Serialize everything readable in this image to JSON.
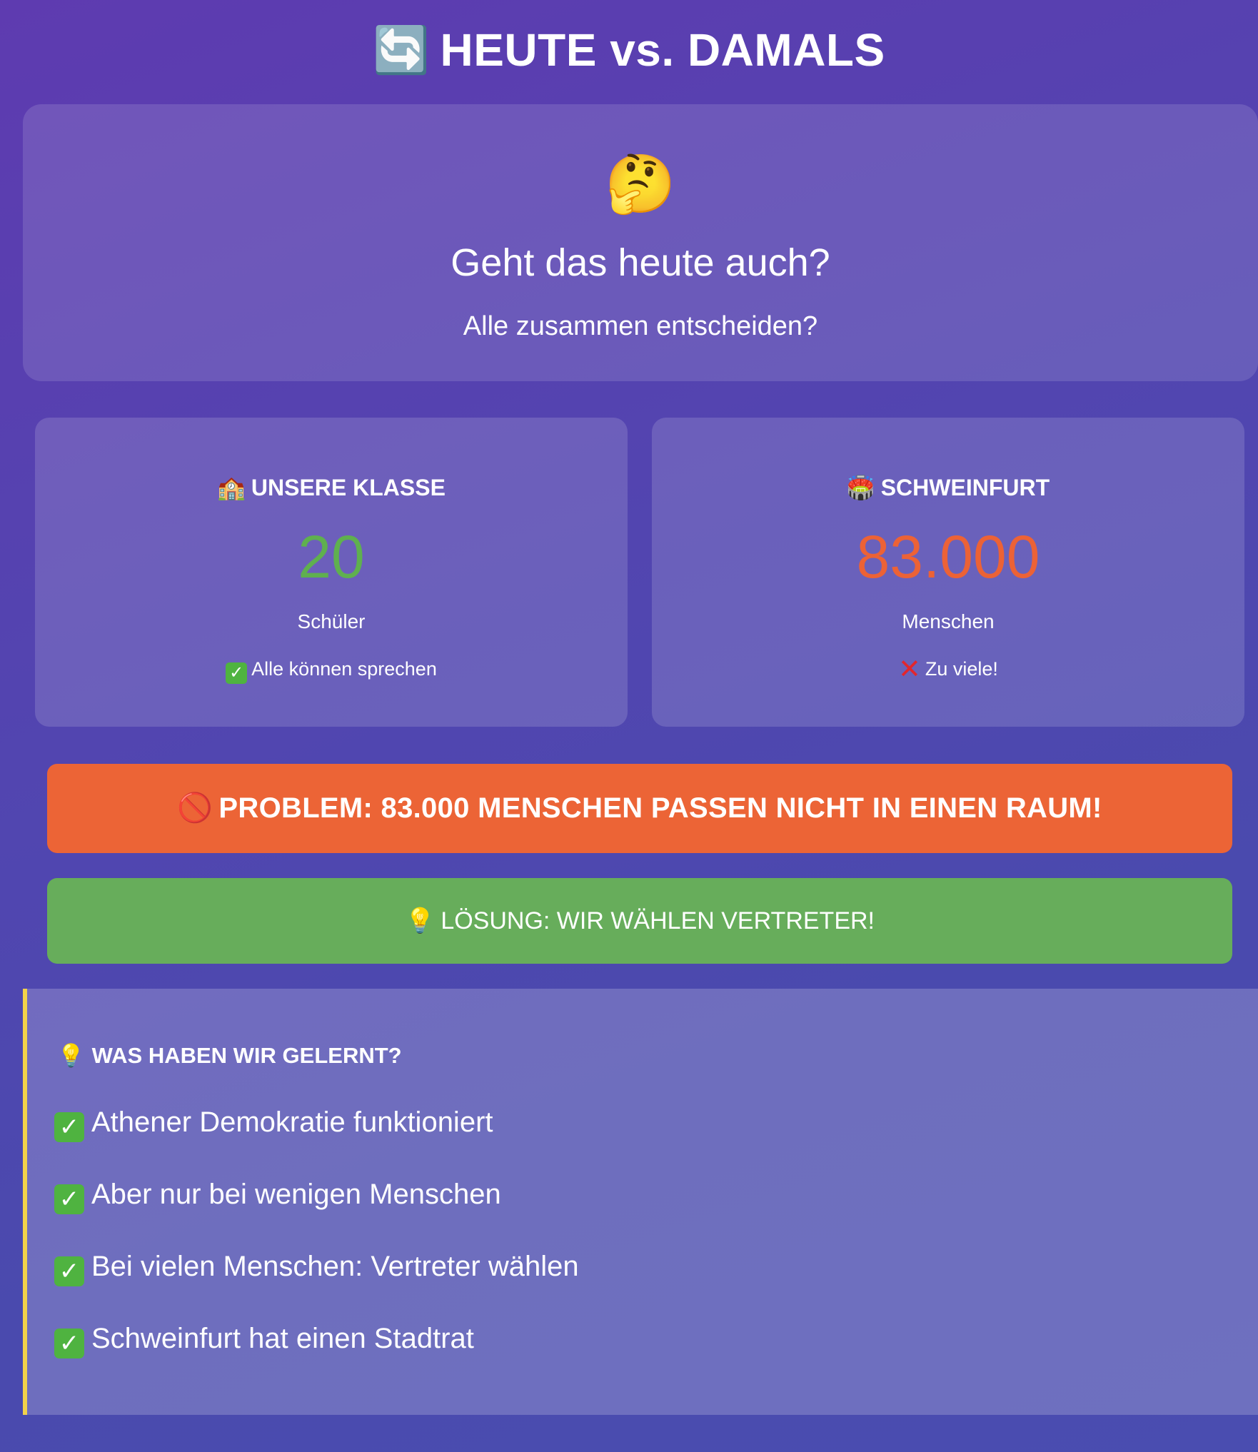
{
  "header": {
    "icon": "🔄",
    "title": "HEUTE vs. DAMALS"
  },
  "question": {
    "icon": "🤔",
    "title": "Geht das heute auch?",
    "subtitle": "Alle zusammen entscheiden?"
  },
  "class_card": {
    "icon": "🏫",
    "title": "UNSERE KLASSE",
    "number": "20",
    "unit": "Schüler",
    "note": "Alle können sprechen",
    "number_color": "#5fb04f"
  },
  "city_card": {
    "icon": "🏟️",
    "title": "SCHWEINFURT",
    "number": "83.000",
    "unit": "Menschen",
    "note": "Zu viele!",
    "number_color": "#ec6236"
  },
  "problem": {
    "icon": "🚫",
    "text": "PROBLEM: 83.000 MENSCHEN PASSEN NICHT IN EINEN RAUM!",
    "color": "#ec6436"
  },
  "solution": {
    "icon": "💡",
    "text": "LÖSUNG: WIR WÄHLEN VERTRETER!",
    "color": "#67ad5b"
  },
  "learned": {
    "icon": "💡",
    "title": "WAS HABEN WIR GELERNT?",
    "items": [
      "Athener Demokratie funktioniert",
      "Aber nur bei wenigen Menschen",
      "Bei vielen Menschen: Vertreter wählen",
      "Schweinfurt hat einen Stadtrat"
    ],
    "accent": "#f3d24a"
  }
}
